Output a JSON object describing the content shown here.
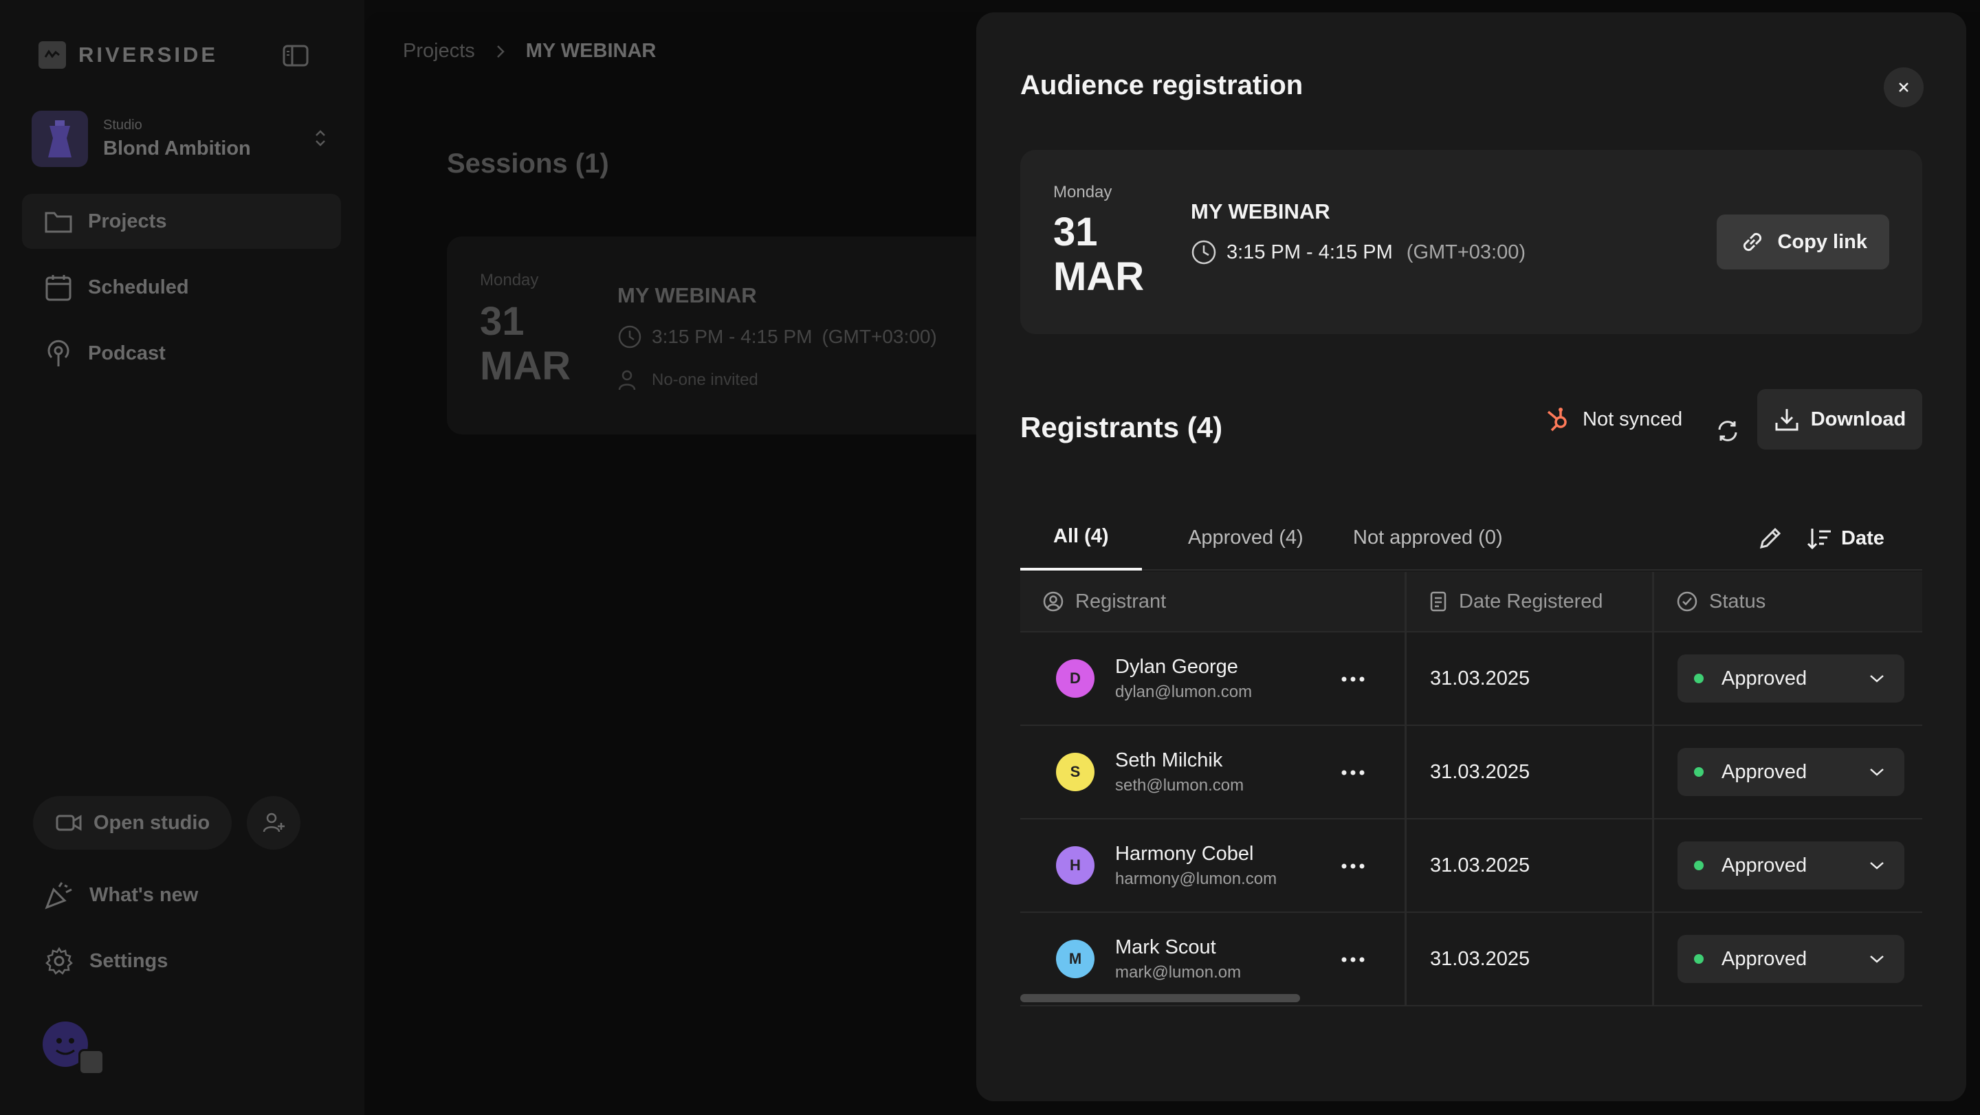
{
  "sidebar": {
    "logo_text": "RIVERSIDE",
    "studio_label": "Studio",
    "studio_name": "Blond Ambition",
    "nav": [
      {
        "label": "Projects",
        "icon": "folder-icon"
      },
      {
        "label": "Scheduled",
        "icon": "calendar-icon"
      },
      {
        "label": "Podcast",
        "icon": "podcast-icon"
      }
    ],
    "open_studio_label": "Open studio",
    "bottom_nav": [
      {
        "label": "What's new",
        "icon": "party-popper-icon"
      },
      {
        "label": "Settings",
        "icon": "gear-icon"
      }
    ]
  },
  "main": {
    "breadcrumb": {
      "root": "Projects",
      "current": "MY WEBINAR"
    },
    "sessions_title": "Sessions (1)",
    "session": {
      "day": "Monday",
      "date_num": "31",
      "date_month": "MAR",
      "title": "MY WEBINAR",
      "time": "3:15 PM - 4:15 PM",
      "tz": "(GMT+03:00)",
      "invited": "No-one invited"
    }
  },
  "modal": {
    "title": "Audience registration",
    "event": {
      "day": "Monday",
      "date_num": "31",
      "date_month": "MAR",
      "title": "MY WEBINAR",
      "time": "3:15 PM - 4:15 PM",
      "tz": "(GMT+03:00)",
      "copy_label": "Copy link"
    },
    "registrants_title": "Registrants (4)",
    "sync_status": "Not synced",
    "download_label": "Download",
    "tabs": [
      "All (4)",
      "Approved (4)",
      "Not approved (0)"
    ],
    "sort_label": "Date",
    "columns": [
      "Registrant",
      "Date Registered",
      "Status"
    ],
    "rows": [
      {
        "initial": "D",
        "name": "Dylan George",
        "email": "dylan@lumon.com",
        "date": "31.03.2025",
        "status": "Approved",
        "avatar_color": "#d55ee8"
      },
      {
        "initial": "S",
        "name": "Seth Milchik",
        "email": "seth@lumon.com",
        "date": "31.03.2025",
        "status": "Approved",
        "avatar_color": "#f3e35a"
      },
      {
        "initial": "H",
        "name": "Harmony Cobel",
        "email": "harmony@lumon.com",
        "date": "31.03.2025",
        "status": "Approved",
        "avatar_color": "#a97cf0"
      },
      {
        "initial": "M",
        "name": "Mark Scout",
        "email": "mark@lumon.om",
        "date": "31.03.2025",
        "status": "Approved",
        "avatar_color": "#6cc4f2"
      }
    ],
    "scroll_fraction": 0.31
  },
  "colors": {
    "status_approved": "#3fcf74",
    "hubspot_orange": "#ff7a59"
  }
}
